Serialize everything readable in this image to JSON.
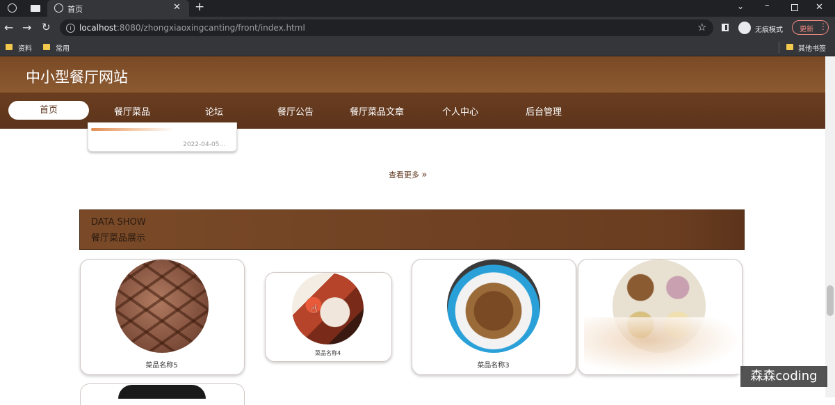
{
  "browser": {
    "tab_title": "首页",
    "url_host": "localhost",
    "url_rest": ":8080/zhongxiaoxingcanting/front/index.html",
    "incognito_label": "无痕模式",
    "update_label": "更新",
    "bookmarks": [
      "资料",
      "常用"
    ],
    "other_bookmarks": "其他书签"
  },
  "site": {
    "title": "中小型餐厅网站",
    "nav": [
      "首页",
      "餐厅菜品",
      "论坛",
      "餐厅公告",
      "餐厅菜品文章",
      "个人中心",
      "后台管理"
    ]
  },
  "news_card": {
    "date": "2022-04-05..."
  },
  "more_link": "查看更多",
  "section": {
    "en": "DATA SHOW",
    "cn": "餐厅菜品展示"
  },
  "dishes": [
    "菜品名称5",
    "菜品名称4",
    "菜品名称3"
  ],
  "watermark": "森森coding",
  "colors": {
    "brand_brown": "#6a3d20",
    "header_brown": "#7a4a26"
  }
}
